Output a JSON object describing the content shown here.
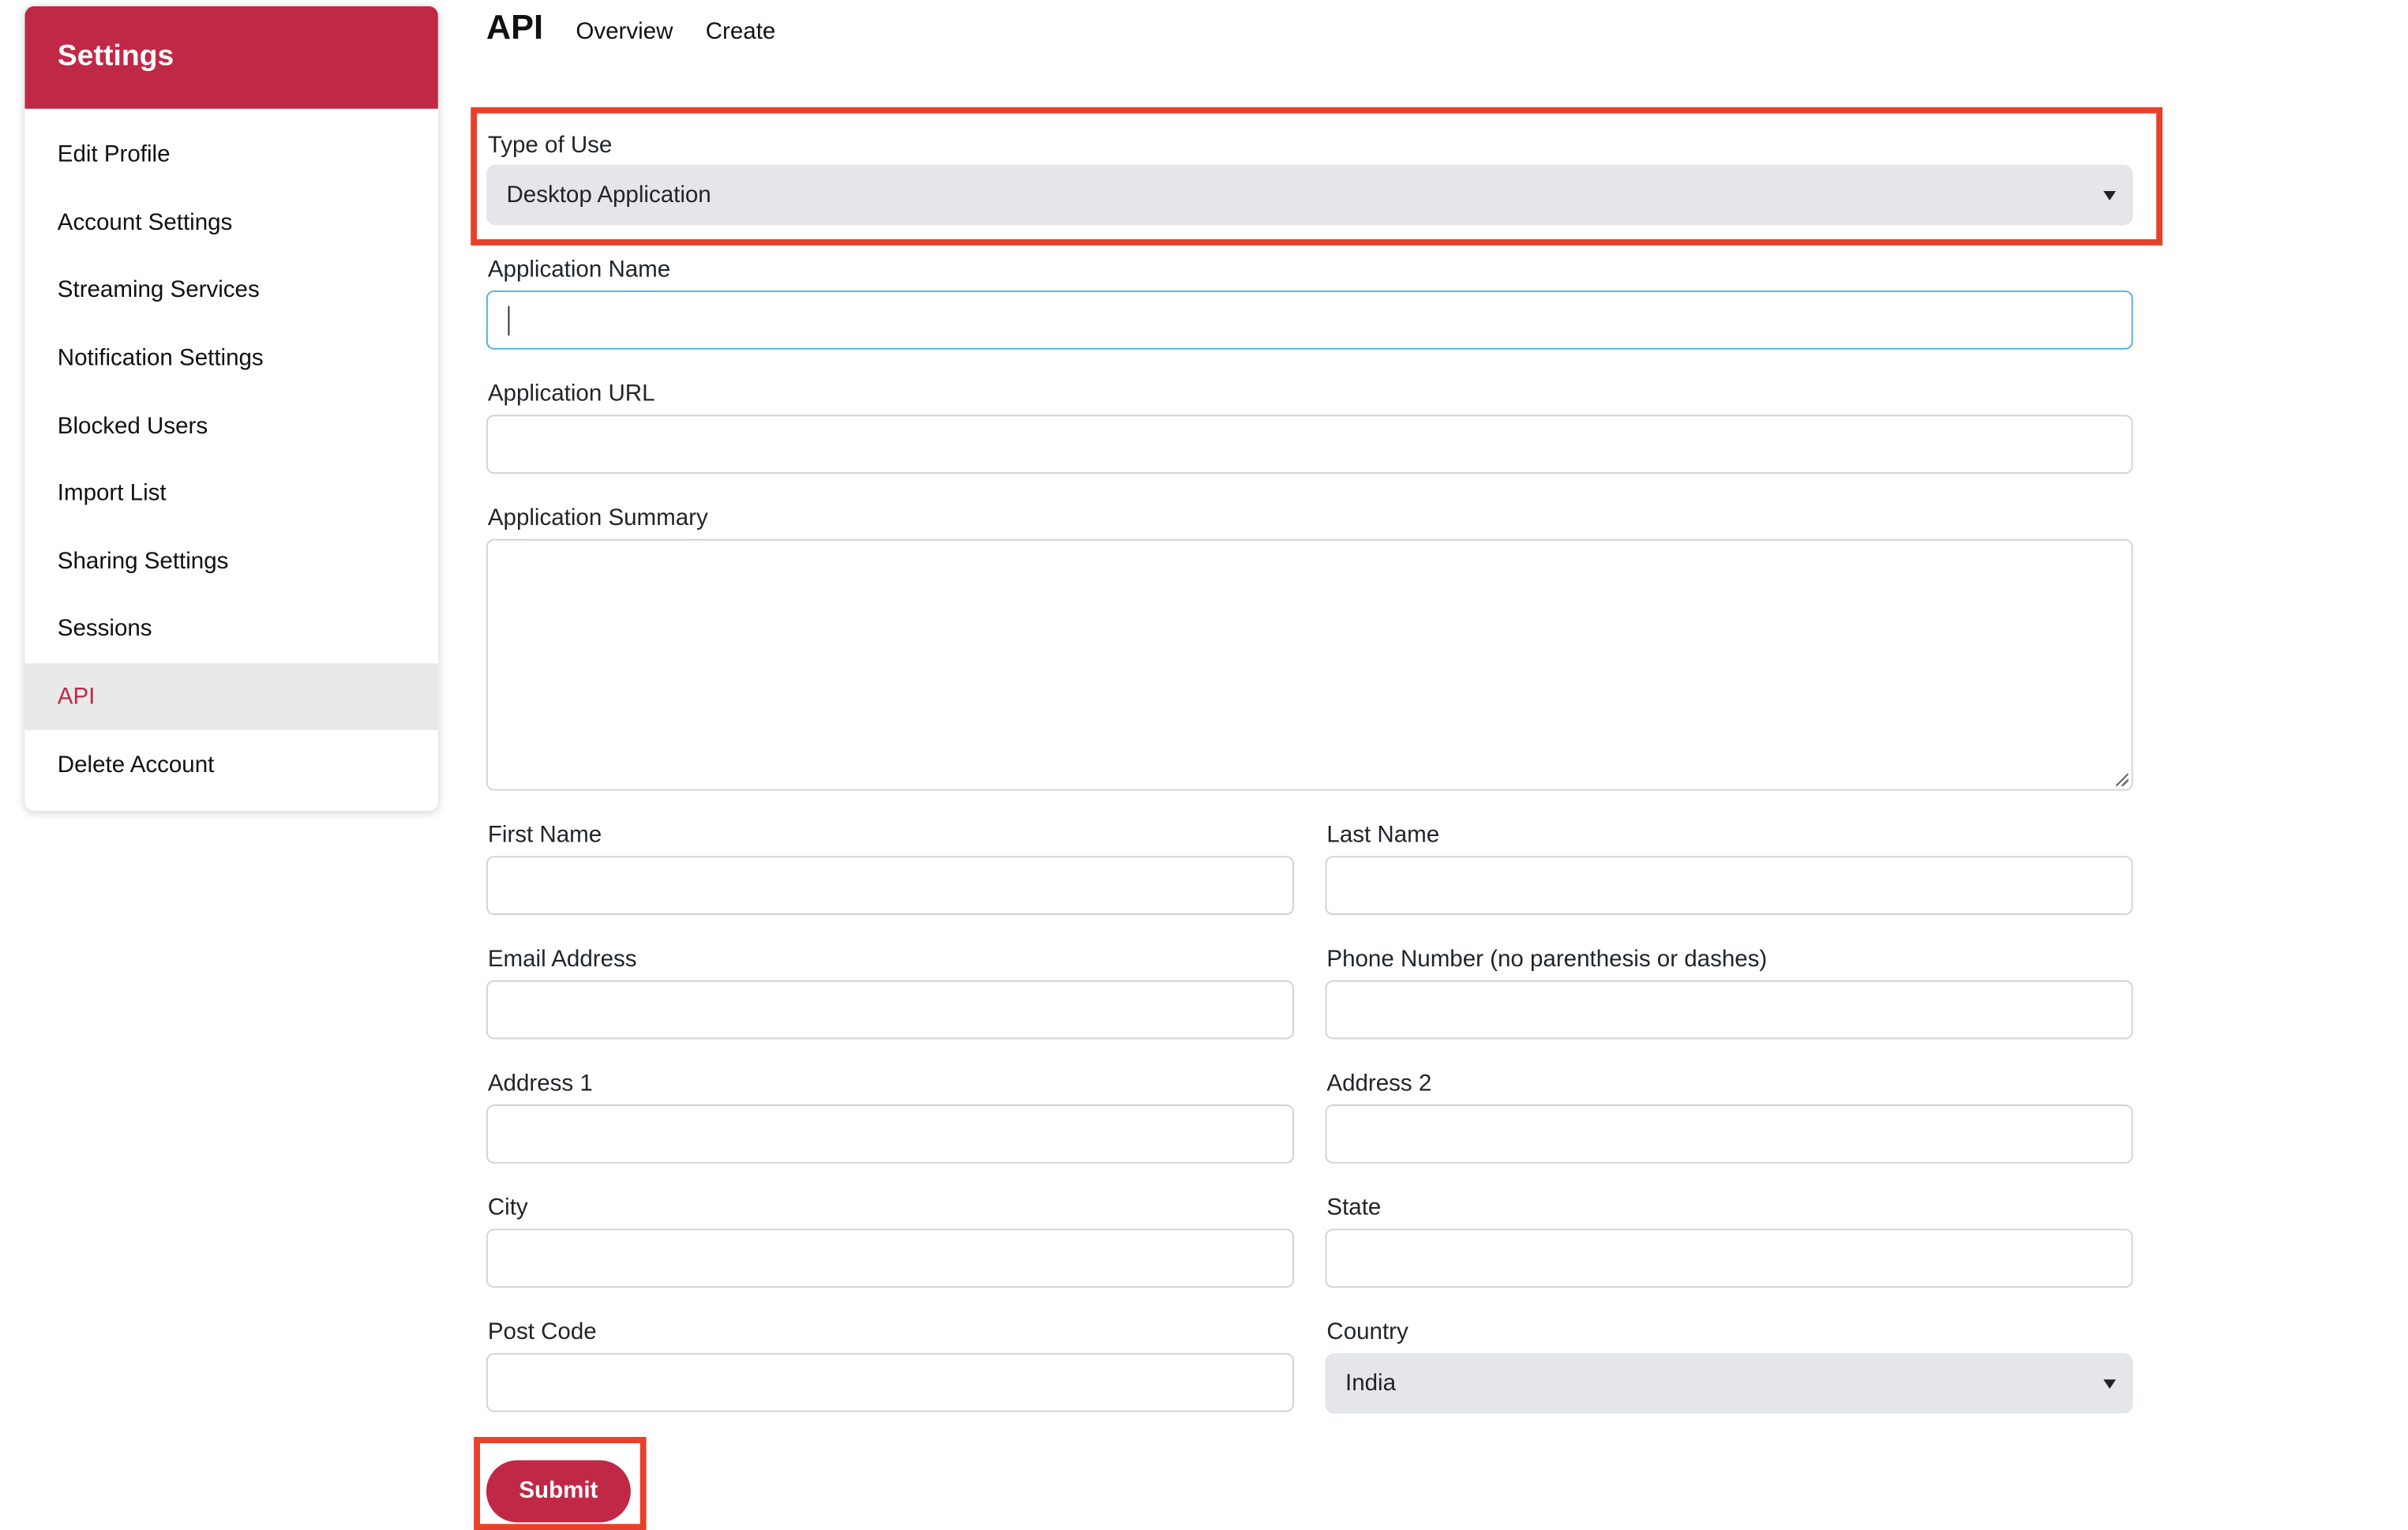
{
  "sidebar": {
    "title": "Settings",
    "items": [
      {
        "label": "Edit Profile",
        "active": false
      },
      {
        "label": "Account Settings",
        "active": false
      },
      {
        "label": "Streaming Services",
        "active": false
      },
      {
        "label": "Notification Settings",
        "active": false
      },
      {
        "label": "Blocked Users",
        "active": false
      },
      {
        "label": "Import List",
        "active": false
      },
      {
        "label": "Sharing Settings",
        "active": false
      },
      {
        "label": "Sessions",
        "active": false
      },
      {
        "label": "API",
        "active": true
      },
      {
        "label": "Delete Account",
        "active": false
      }
    ]
  },
  "header": {
    "title": "API",
    "links": [
      "Overview",
      "Create"
    ]
  },
  "form": {
    "type_of_use": {
      "label": "Type of Use",
      "value": "Desktop Application"
    },
    "application_name": {
      "label": "Application Name",
      "value": ""
    },
    "application_url": {
      "label": "Application URL",
      "value": ""
    },
    "application_summary": {
      "label": "Application Summary",
      "value": ""
    },
    "first_name": {
      "label": "First Name",
      "value": ""
    },
    "last_name": {
      "label": "Last Name",
      "value": ""
    },
    "email": {
      "label": "Email Address",
      "value": ""
    },
    "phone": {
      "label": "Phone Number (no parenthesis or dashes)",
      "value": ""
    },
    "address1": {
      "label": "Address 1",
      "value": ""
    },
    "address2": {
      "label": "Address 2",
      "value": ""
    },
    "city": {
      "label": "City",
      "value": ""
    },
    "state": {
      "label": "State",
      "value": ""
    },
    "post_code": {
      "label": "Post Code",
      "value": ""
    },
    "country": {
      "label": "Country",
      "value": "India"
    },
    "submit_label": "Submit"
  },
  "colors": {
    "brand": "#c12846",
    "highlight": "#e8412a",
    "focus": "#5ab0d9"
  }
}
